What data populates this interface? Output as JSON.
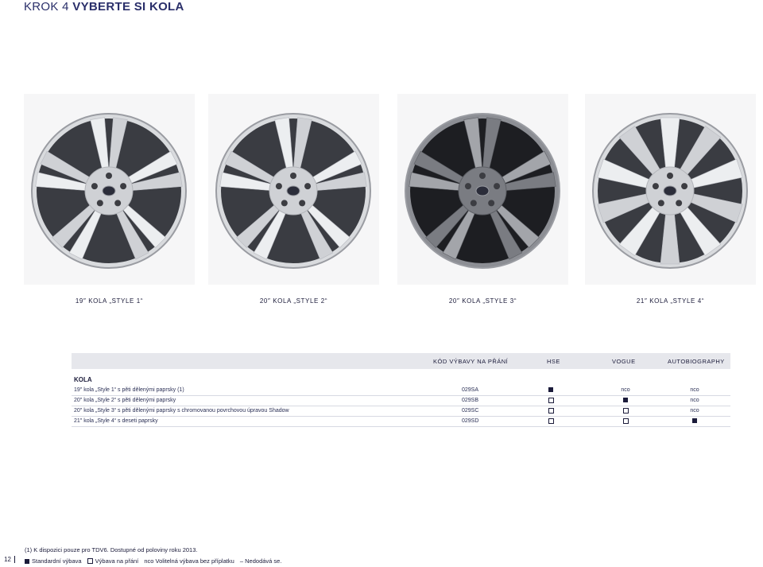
{
  "header": {
    "step": "KROK 4",
    "title": "VYBERTE SI KOLA"
  },
  "wheels": [
    {
      "caption": "19″ KOLA „STYLE 1“",
      "finish": "silver"
    },
    {
      "caption": "20″ KOLA „STYLE 2“",
      "finish": "silver"
    },
    {
      "caption": "20″ KOLA „STYLE 3“",
      "finish": "shadow"
    },
    {
      "caption": "21″ KOLA „STYLE 4“",
      "finish": "silver"
    }
  ],
  "table": {
    "headers": {
      "code": "KÓD VÝBAVY NA PŘÁNÍ",
      "hse": "HSE",
      "vogue": "VOGUE",
      "autobiography": "AUTOBIOGRAPHY"
    },
    "section": "KOLA",
    "rows": [
      {
        "desc": "19″ kola „Style 1“ s pěti dělenými paprsky (1)",
        "code": "029SA",
        "hse": "filled",
        "vogue": "nco",
        "autobiography": "nco"
      },
      {
        "desc": "20″ kola „Style 2“ s pěti dělenými paprsky",
        "code": "029SB",
        "hse": "empty",
        "vogue": "filled",
        "autobiography": "nco"
      },
      {
        "desc": "20″ kola „Style 3“ s pěti dělenými paprsky s chromovanou povrchovou úpravou Shadow",
        "code": "029SC",
        "hse": "empty",
        "vogue": "empty",
        "autobiography": "nco"
      },
      {
        "desc": "21″ kola „Style 4“ s deseti paprsky",
        "code": "029SD",
        "hse": "empty",
        "vogue": "empty",
        "autobiography": "filled"
      }
    ]
  },
  "footnote": "(1) K dispozici pouze pro TDV6. Dostupné od poloviny roku 2013.",
  "legend": {
    "standard": "Standardní výbava",
    "option": "Výbava na přání",
    "nco_key": "nco",
    "nco_desc": "Volitelná výbava bez příplatku",
    "na_key": "–",
    "na_desc": "Nedodává se."
  },
  "page_number": "12"
}
